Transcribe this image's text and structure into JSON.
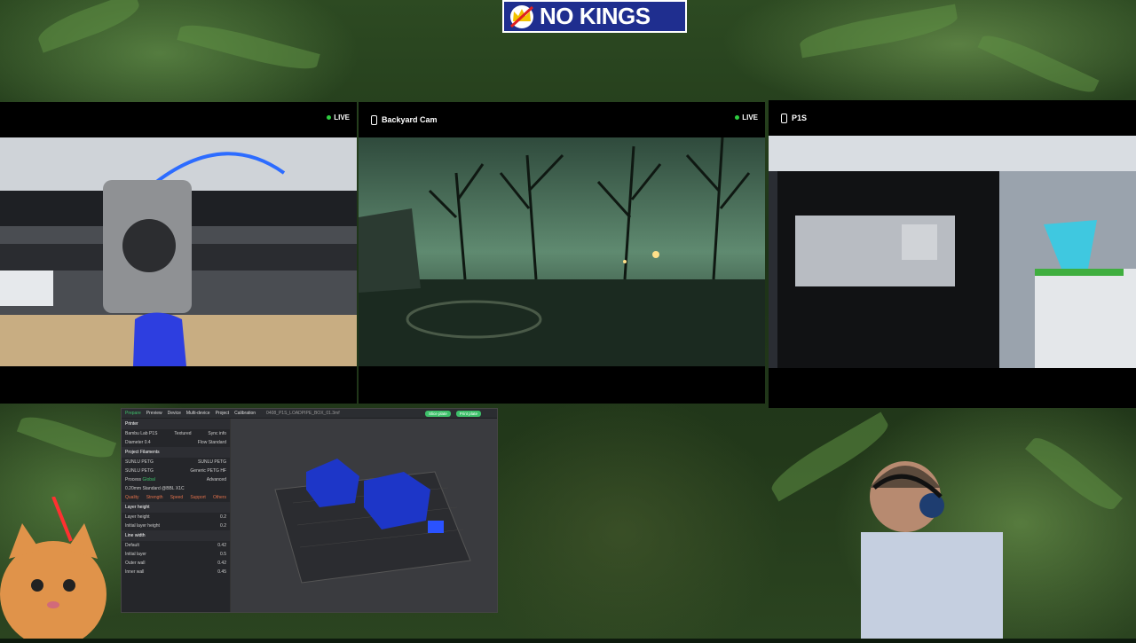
{
  "banner": {
    "text": "NO KINGS",
    "bg": "#1f2e8f"
  },
  "cameras": [
    {
      "title": "",
      "live": "LIVE"
    },
    {
      "title": "Backyard Cam",
      "live": "LIVE"
    },
    {
      "title": "P1S",
      "live": ""
    }
  ],
  "slicer": {
    "tabs": [
      "Prepare",
      "Preview",
      "Device",
      "Multi-device",
      "Project",
      "Calibration"
    ],
    "window_title": "0408_P1S_LOADPIPE_BOX_01.3mf",
    "slice_button": "Slice plate",
    "print_button": "Print plate",
    "printer_section": "Printer",
    "printer_name": "Bambu Lab P1S",
    "plate_label": "Textured",
    "sync_label": "Sync info",
    "nozzle_label": "Diameter",
    "nozzle_value": "0.4",
    "flow_label": "Flow",
    "flow_value": "Standard",
    "filament_section": "Project Filaments",
    "filaments": [
      "SUNLU PETG",
      "SUNLU PETG",
      "SUNLU PETG",
      "Generic PETG HF"
    ],
    "process_label": "Process",
    "process_mode": "Global",
    "advanced_label": "Advanced",
    "profile": "0.20mm Standard @BBL X1C",
    "process_tabs": [
      "Quality",
      "Strength",
      "Speed",
      "Support",
      "Others"
    ],
    "layer_section": "Layer height",
    "layer_rows": [
      {
        "label": "Layer height",
        "value": "0.2"
      },
      {
        "label": "Initial layer height",
        "value": "0.2"
      }
    ],
    "line_section": "Line width",
    "line_rows": [
      {
        "label": "Default",
        "value": "0.42"
      },
      {
        "label": "Initial layer",
        "value": "0.5"
      },
      {
        "label": "Outer wall",
        "value": "0.42"
      },
      {
        "label": "Inner wall",
        "value": "0.45"
      }
    ]
  },
  "colors": {
    "live": "#2ecc40",
    "accent": "#3ec06a",
    "model": "#1d36c8"
  }
}
